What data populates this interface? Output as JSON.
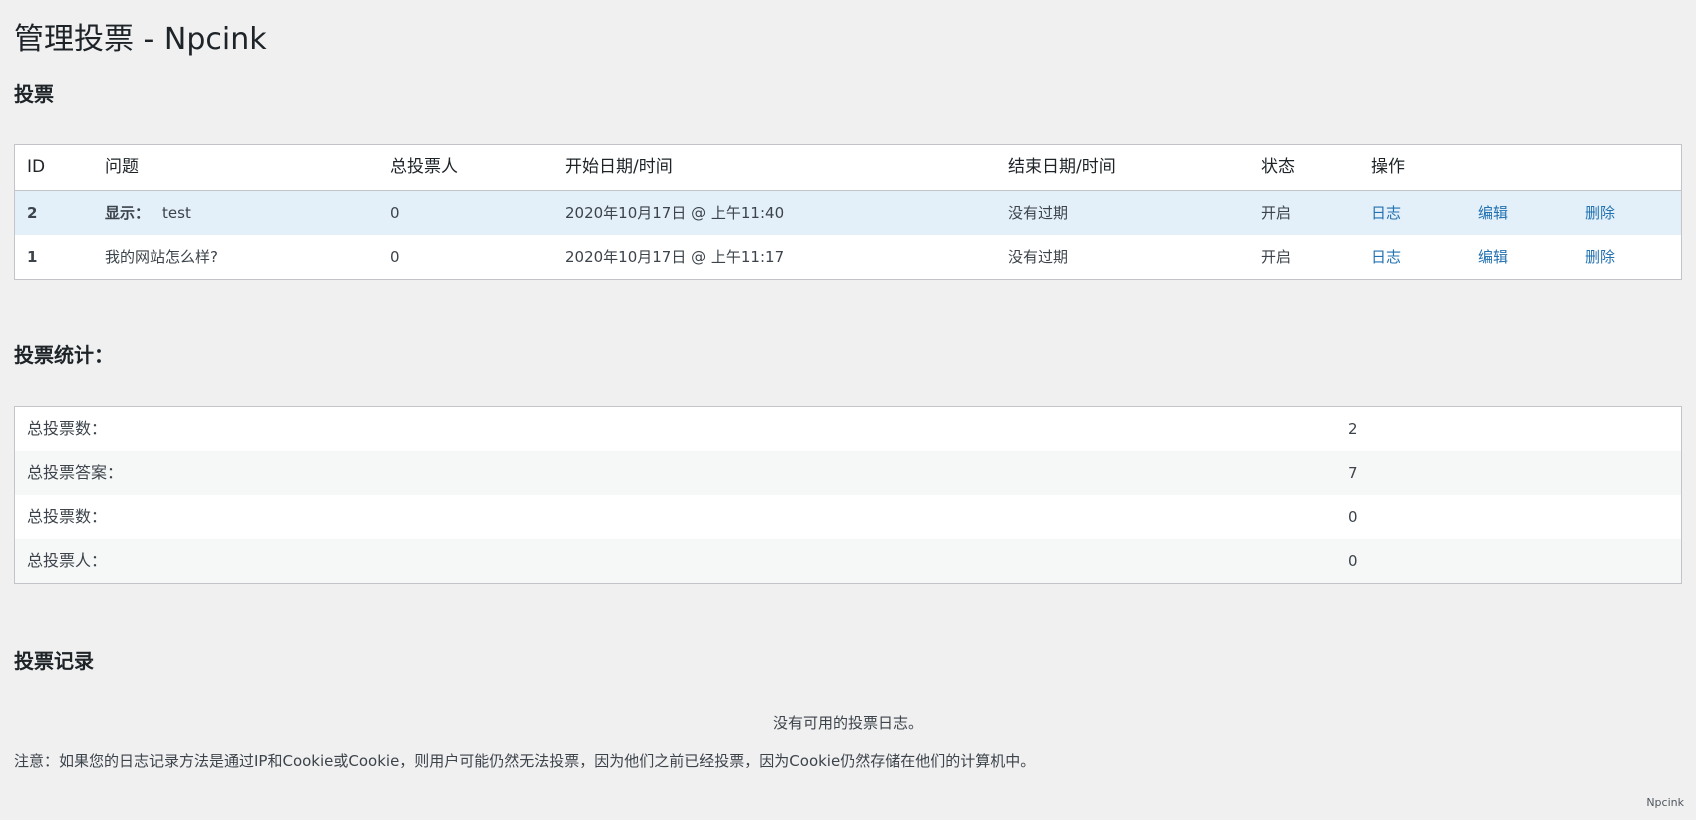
{
  "page": {
    "title": "管理投票 - Npcink"
  },
  "polls_section": {
    "heading": "投票",
    "columns": {
      "id": "ID",
      "question": "问题",
      "voters": "总投票人",
      "start": "开始日期/时间",
      "end": "结束日期/时间",
      "status": "状态",
      "actions": "操作"
    },
    "rows": [
      {
        "id": "2",
        "question_prefix": "显示：",
        "question": "test",
        "voters": "0",
        "start": "2020年10月17日 @ 上午11:40",
        "end": "没有过期",
        "status": "开启",
        "log": "日志",
        "edit": "编辑",
        "delete": "删除"
      },
      {
        "id": "1",
        "question_prefix": "",
        "question": "我的网站怎么样?",
        "voters": "0",
        "start": "2020年10月17日 @ 上午11:17",
        "end": "没有过期",
        "status": "开启",
        "log": "日志",
        "edit": "编辑",
        "delete": "删除"
      }
    ]
  },
  "stats_section": {
    "heading": "投票统计：",
    "rows": [
      {
        "label": "总投票数：",
        "value": "2"
      },
      {
        "label": "总投票答案：",
        "value": "7"
      },
      {
        "label": "总投票数：",
        "value": "0"
      },
      {
        "label": "总投票人：",
        "value": "0"
      }
    ]
  },
  "logs_section": {
    "heading": "投票记录",
    "empty_message": "没有可用的投票日志。",
    "note": "注意：如果您的日志记录方法是通过IP和Cookie或Cookie，则用户可能仍然无法投票，因为他们之前已经投票，因为Cookie仍然存储在他们的计算机中。"
  },
  "footer": {
    "text": "Npcink"
  },
  "colors": {
    "link": "#2271b1",
    "highlight_row": "#e3f0fa",
    "background": "#f0f0f1"
  }
}
